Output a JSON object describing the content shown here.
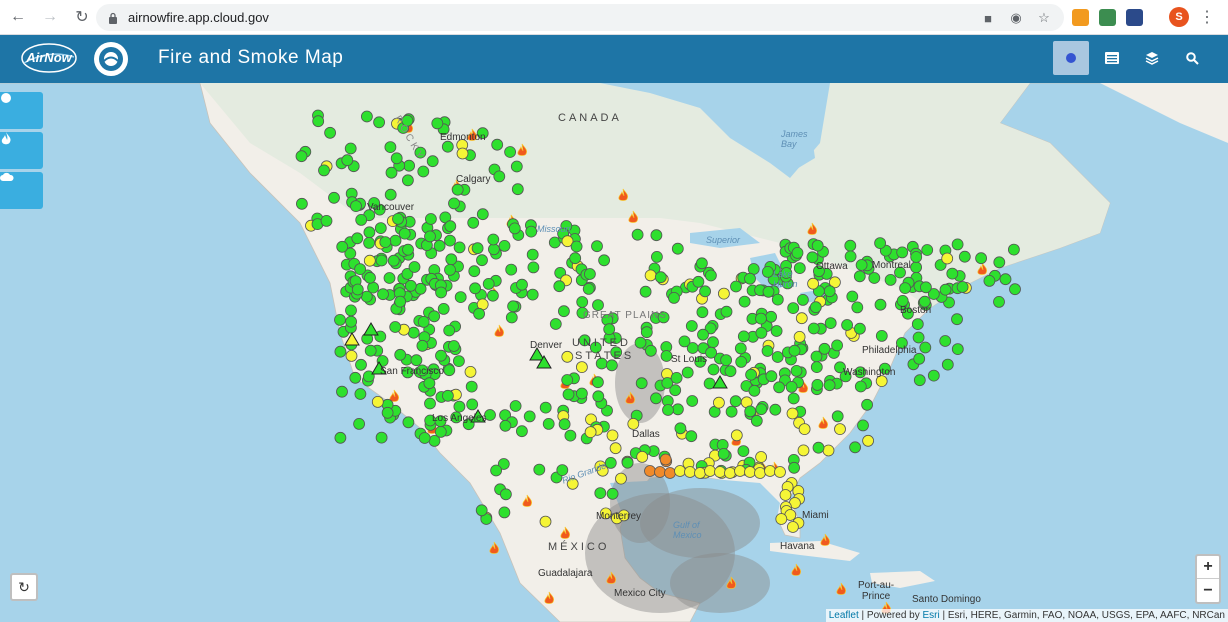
{
  "browser": {
    "url": "airnowfire.app.cloud.gov",
    "profile_initial": "S"
  },
  "header": {
    "title": "Fire and Smoke Map"
  },
  "map": {
    "labels": {
      "canada": "CANADA",
      "united_states_1": "UNITED",
      "united_states_2": "STATES",
      "mexico": "MÉXICO",
      "great_plains": "GREAT PLAINS",
      "rocky": "ROCKY",
      "edmonton": "Edmonton",
      "calgary": "Calgary",
      "vancouver": "Vancouver",
      "james_bay": "James\nBay",
      "superior": "Superior",
      "missouri": "Missouri",
      "ottawa": "Ottawa",
      "montreal": "Montreal",
      "boston": "Boston",
      "philadelphia": "Philadelphia",
      "washington": "Washington",
      "denver": "Denver",
      "st_louis": "St Louis",
      "san_francisco": "San Francisco",
      "los_angeles": "Los Angeles",
      "dallas": "Dallas",
      "monterrey": "Monterrey",
      "guadalajara": "Guadalajara",
      "mexico_city": "Mexico City",
      "havana": "Havana",
      "miami": "Miami",
      "port_au_prince": "Port-au-\nPrince",
      "santo_domingo": "Santo Domingo",
      "gulf_of_mexico": "Gulf of\nMexico",
      "rio_grande": "Rio Grande",
      "lake_huron": "Lake\nHuron"
    },
    "attribution": {
      "leaflet": "Leaflet",
      "powered_by": "| Powered by",
      "esri": "Esri",
      "sources": "| Esri, HERE, Garmin, FAO, NOAA, USGS, EPA, AAFC, NRCan"
    },
    "zoom_in": "+",
    "zoom_out": "−"
  },
  "colors": {
    "good": "#2ee02e",
    "moderate": "#f5f536",
    "usg": "#f08a2a",
    "header": "#1e75a6",
    "side_button": "#3aaee0"
  },
  "icons": {
    "monitors": "circle-icon",
    "fires": "fire-icon",
    "smoke": "cloud-icon",
    "list": "list-icon",
    "layers": "layers-icon",
    "search": "search-icon",
    "refresh": "refresh-icon"
  }
}
